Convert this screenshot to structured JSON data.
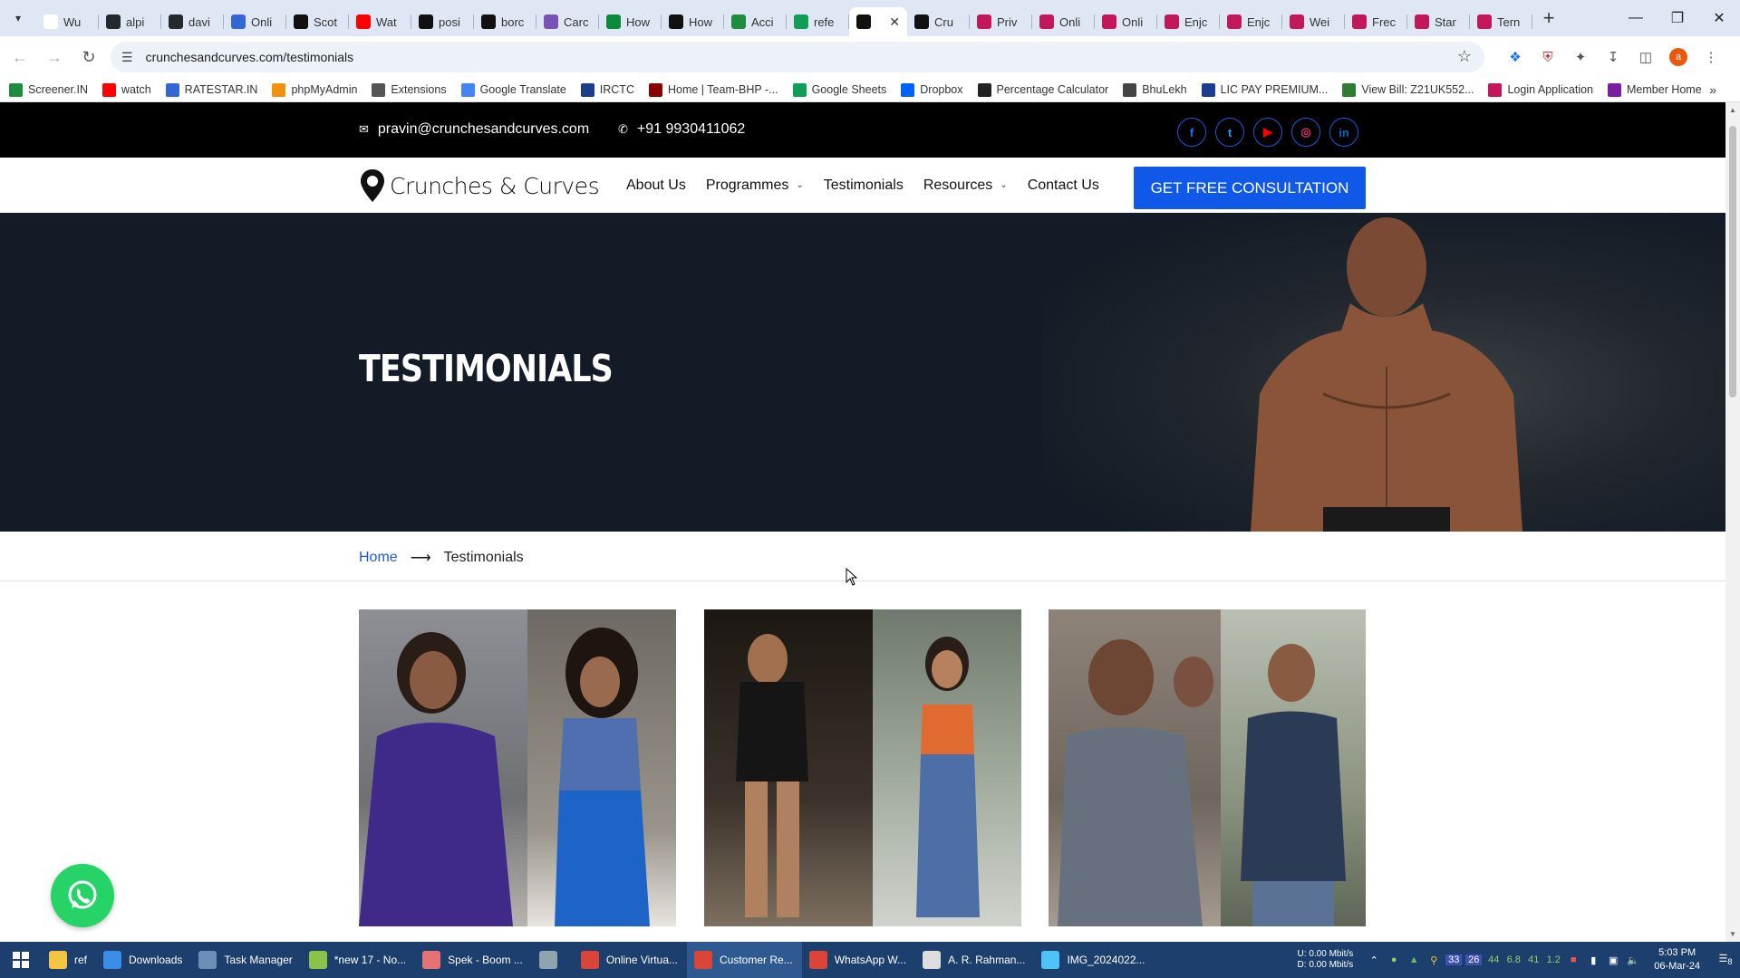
{
  "browser": {
    "tabs": [
      {
        "title": "Wu",
        "icon": "google-icon",
        "color": "#ffffff"
      },
      {
        "title": "alpi",
        "icon": "github-icon",
        "color": "#24292e"
      },
      {
        "title": "davi",
        "icon": "github-icon",
        "color": "#24292e"
      },
      {
        "title": "Onli",
        "icon": "globe-icon",
        "color": "#3367d6"
      },
      {
        "title": "Scot",
        "icon": "scribd-icon",
        "color": "#111111"
      },
      {
        "title": "Wat",
        "icon": "youtube-icon",
        "color": "#ff0000"
      },
      {
        "title": "posi",
        "icon": "medium-icon",
        "color": "#111111"
      },
      {
        "title": "borc",
        "icon": "medium-icon",
        "color": "#111111"
      },
      {
        "title": "Carc",
        "icon": "bootstrap-icon",
        "color": "#7952b3"
      },
      {
        "title": "How",
        "icon": "w-icon",
        "color": "#0b8a3e"
      },
      {
        "title": "How",
        "icon": "a-icon",
        "color": "#111111"
      },
      {
        "title": "Acci",
        "icon": "link-icon",
        "color": "#1e8e3e"
      },
      {
        "title": "refe",
        "icon": "sheets-icon",
        "color": "#0f9d58"
      },
      {
        "title": "",
        "icon": "pin-icon",
        "color": "#111111",
        "active": true
      },
      {
        "title": "Cru",
        "icon": "pin-icon",
        "color": "#111111"
      },
      {
        "title": "Priv",
        "icon": "mask-icon",
        "color": "#c2185b"
      },
      {
        "title": "Onli",
        "icon": "mask-icon",
        "color": "#c2185b"
      },
      {
        "title": "Onli",
        "icon": "mask-icon",
        "color": "#c2185b"
      },
      {
        "title": "Enjc",
        "icon": "mask-icon",
        "color": "#c2185b"
      },
      {
        "title": "Enjc",
        "icon": "mask-icon",
        "color": "#c2185b"
      },
      {
        "title": "Wei",
        "icon": "mask-icon",
        "color": "#c2185b"
      },
      {
        "title": "Frec",
        "icon": "mask-icon",
        "color": "#c2185b"
      },
      {
        "title": "Star",
        "icon": "mask-icon",
        "color": "#c2185b"
      },
      {
        "title": "Tern",
        "icon": "mask-icon",
        "color": "#c2185b"
      }
    ],
    "url": "crunchesandcurves.com/testimonials",
    "bookmarks": [
      {
        "label": "Screener.IN",
        "color": "#1e8e3e"
      },
      {
        "label": "watch",
        "color": "#ff0000"
      },
      {
        "label": "RATESTAR.IN",
        "color": "#3367d6"
      },
      {
        "label": "phpMyAdmin",
        "color": "#f29111"
      },
      {
        "label": "Extensions",
        "color": "#555555"
      },
      {
        "label": "Google Translate",
        "color": "#4285f4"
      },
      {
        "label": "IRCTC",
        "color": "#1a3d8f"
      },
      {
        "label": "Home | Team-BHP -...",
        "color": "#8b0000"
      },
      {
        "label": "Google Sheets",
        "color": "#0f9d58"
      },
      {
        "label": "Dropbox",
        "color": "#0061ff"
      },
      {
        "label": "Percentage Calculator",
        "color": "#222222"
      },
      {
        "label": "BhuLekh",
        "color": "#444444"
      },
      {
        "label": "LIC PAY PREMIUM...",
        "color": "#1a3d8f"
      },
      {
        "label": "View Bill: Z21UK552...",
        "color": "#2e7d32"
      },
      {
        "label": "Login Application",
        "color": "#c2185b"
      },
      {
        "label": "Member Home",
        "color": "#7b1fa2"
      }
    ]
  },
  "site": {
    "email": "pravin@crunchesandcurves.com",
    "phone": "+91 9930411062",
    "socials": [
      {
        "name": "facebook",
        "glyph": "f",
        "color": "#1877f2"
      },
      {
        "name": "twitter",
        "glyph": "t",
        "color": "#1da1f2"
      },
      {
        "name": "youtube",
        "glyph": "▶",
        "color": "#ff0000"
      },
      {
        "name": "instagram",
        "glyph": "◎",
        "color": "#e1306c"
      },
      {
        "name": "linkedin",
        "glyph": "in",
        "color": "#0a66c2"
      }
    ],
    "brand": "Crunches & Curves",
    "nav": {
      "about": "About Us",
      "programmes": "Programmes",
      "testimonials": "Testimonials",
      "resources": "Resources",
      "contact": "Contact Us"
    },
    "cta": "GET FREE CONSULTATION",
    "hero_title": "TESTIMONIALS",
    "breadcrumb": {
      "home": "Home",
      "current": "Testimonials"
    },
    "accent": "#1058e8"
  },
  "taskbar": {
    "items": [
      {
        "label": "ref",
        "icon": "folder-icon",
        "color": "#f4c542"
      },
      {
        "label": "Downloads",
        "icon": "download-icon",
        "color": "#3a8ee6"
      },
      {
        "label": "Task Manager",
        "icon": "taskmanager-icon",
        "color": "#6b8fb8"
      },
      {
        "label": "*new 17 - No...",
        "icon": "notepad-icon",
        "color": "#8bc34a"
      },
      {
        "label": "Spek - Boom ...",
        "icon": "spek-icon",
        "color": "#e57373"
      },
      {
        "label": "",
        "icon": "file-icon",
        "color": "#90a4ae"
      },
      {
        "label": "Online Virtua...",
        "icon": "chrome-icon",
        "color": "#db4437"
      },
      {
        "label": "Customer Re...",
        "icon": "chrome-icon",
        "color": "#db4437",
        "active": true
      },
      {
        "label": "WhatsApp W...",
        "icon": "chrome-icon",
        "color": "#db4437"
      },
      {
        "label": "A. R. Rahman...",
        "icon": "media-icon",
        "color": "#dddddd"
      },
      {
        "label": "IMG_2024022...",
        "icon": "image-icon",
        "color": "#4fc3f7"
      }
    ],
    "net_up_label": "U:",
    "net_up": "0.00 Mbit/s",
    "net_down_label": "D:",
    "net_down": "0.00 Mbit/s",
    "tray_values": [
      "44",
      "6.8",
      "41",
      "1.2"
    ],
    "tray_badges": [
      "33",
      "26"
    ],
    "time": "5:03 PM",
    "date": "06-Mar-24",
    "notification_count": "8"
  }
}
